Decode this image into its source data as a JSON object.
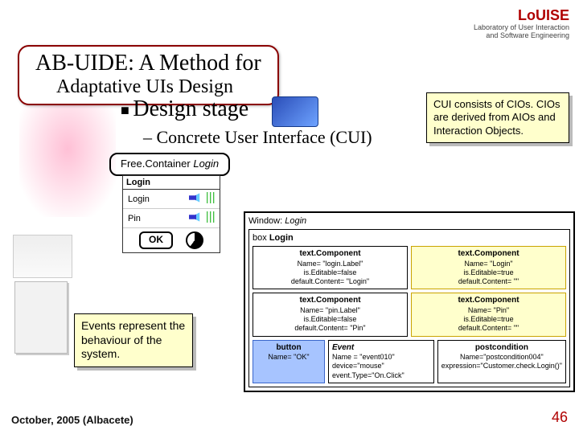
{
  "logo": {
    "name": "LoUISE",
    "tagline1": "Laboratory of User Interaction",
    "tagline2": "and Software Engineering"
  },
  "title": {
    "line1": "AB-UIDE: A Method for",
    "line2": "Adaptative UIs Design"
  },
  "bullets": {
    "design_stage": "Design stage",
    "cui": "– Concrete User Interface (CUI)"
  },
  "callouts": {
    "cui": "CUI consists of CIOs. CIOs are derived from AIOs and Interaction Objects.",
    "events": "Events represent the behaviour of the system."
  },
  "free_container": {
    "label": "Free.Container",
    "value": "Login"
  },
  "login_widget": {
    "header": "Login",
    "row_login": "Login",
    "row_pin": "Pin",
    "ok": "OK"
  },
  "window": {
    "label": "Window:",
    "name": "Login"
  },
  "box": {
    "label": "box",
    "name": "Login"
  },
  "tc": {
    "title": "text.Component",
    "loginLabel": {
      "name": "Name= \"login.Label\"",
      "editable": "is.Editable=false",
      "def": "default.Content= \"Login\""
    },
    "login": {
      "name": "Name= \"Login\"",
      "editable": "is.Editable=true",
      "def": "default.Content= \"\""
    },
    "pinLabel": {
      "name": "Name= \"pin.Label\"",
      "editable": "is.Editable=false",
      "def": "default.Content= \"Pin\""
    },
    "pin": {
      "name": "Name= \"Pin\"",
      "editable": "is.Editable=true",
      "def": "default.Content= \"\""
    }
  },
  "button": {
    "title": "button",
    "name": "Name= \"OK\""
  },
  "event": {
    "title": "Event",
    "name": "Name = \"event010\"",
    "device": "device=\"mouse\"",
    "type": "event.Type=\"On.Click\""
  },
  "postc": {
    "title": "postcondition",
    "name": "Name=\"postcondition004\"",
    "expr": "expression=\"Customer.check.Login()\""
  },
  "footer": {
    "left": "October, 2005 (Albacete)",
    "page": "46"
  }
}
